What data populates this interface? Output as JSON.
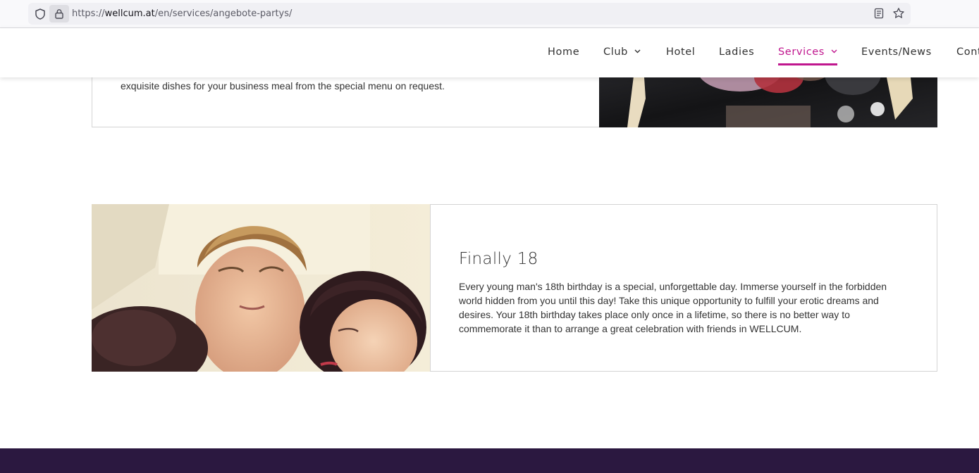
{
  "browser": {
    "url_prefix": "https://",
    "url_domain": "wellcum.at",
    "url_path": "/en/services/angebote-partys/"
  },
  "nav": {
    "items": [
      {
        "label": "Home",
        "dropdown": false,
        "active": false
      },
      {
        "label": "Club",
        "dropdown": true,
        "active": false
      },
      {
        "label": "Hotel",
        "dropdown": false,
        "active": false
      },
      {
        "label": "Ladies",
        "dropdown": false,
        "active": false
      },
      {
        "label": "Services",
        "dropdown": true,
        "active": true
      },
      {
        "label": "Events/News",
        "dropdown": false,
        "active": false
      },
      {
        "label": "Cont",
        "dropdown": false,
        "active": false
      }
    ],
    "active_color": "#c0168e"
  },
  "sections": {
    "business": {
      "text": "exquisite dishes for your business meal from the special menu on request."
    },
    "finally18": {
      "title": "Finally 18",
      "body": "Every young man's 18th birthday is a special, unforgettable day. Immerse yourself in the forbidden world hidden from you until this day! Take this unique opportunity to fulfill your erotic dreams and desires. Your 18th birthday takes place only once in a lifetime, so there is no better way to commemorate it than to arrange a great celebration with friends in WELLCUM."
    }
  },
  "colors": {
    "footer": "#2b1840",
    "accent": "#c0168e"
  }
}
